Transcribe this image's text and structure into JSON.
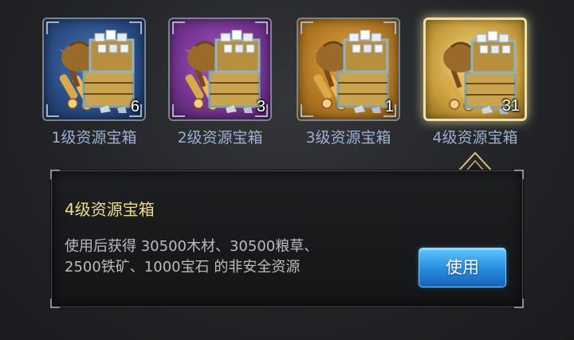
{
  "items": [
    {
      "label": "1级资源宝箱",
      "count": "6",
      "rarity_color": "#2e4f86"
    },
    {
      "label": "2级资源宝箱",
      "count": "3",
      "rarity_color": "#6b2f86"
    },
    {
      "label": "3级资源宝箱",
      "count": "1",
      "rarity_color": "#a8711e"
    },
    {
      "label": "4级资源宝箱",
      "count": "31",
      "rarity_color": "#b68c2d"
    }
  ],
  "selected_index": 3,
  "detail": {
    "title": "4级资源宝箱",
    "description_line1": "使用后获得  30500木材、30500粮草、",
    "description_line2": "2500铁矿、1000宝石  的非安全资源",
    "use_button": "使用"
  },
  "colors": {
    "label_text": "#9ab1cf",
    "title_text": "#f3dc8a",
    "button_blue": "#2a8fe0"
  }
}
